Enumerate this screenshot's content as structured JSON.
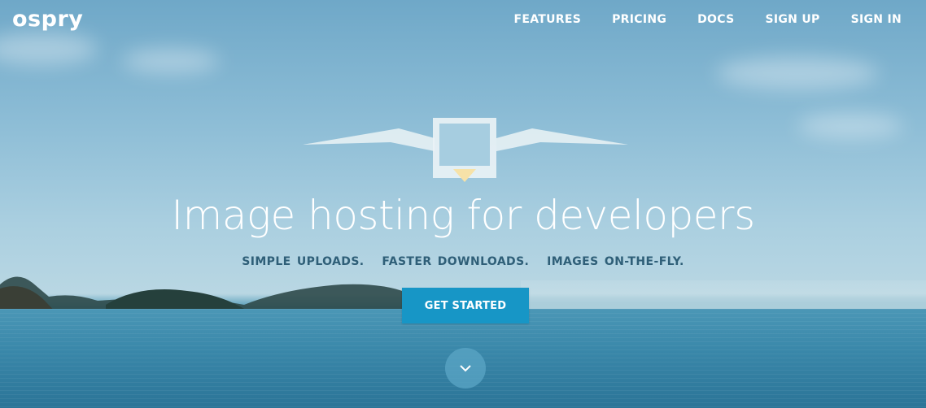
{
  "brand": {
    "logo_text": "ospry"
  },
  "nav": {
    "items": [
      {
        "label": "FEATURES"
      },
      {
        "label": "PRICING"
      },
      {
        "label": "DOCS"
      },
      {
        "label": "SIGN UP"
      },
      {
        "label": "SIGN IN"
      }
    ]
  },
  "hero": {
    "headline": "Image hosting for developers",
    "tagline": "SIMPLE UPLOADS.   FASTER DOWNLOADS.   IMAGES ON-THE-FLY.",
    "cta_label": "GET STARTED",
    "scroll_icon": "chevron-down-icon",
    "logo_icon": "bird-frame-icon"
  },
  "colors": {
    "cta": "#1796c6",
    "tagline": "#2f5f78",
    "text": "#ffffff"
  }
}
